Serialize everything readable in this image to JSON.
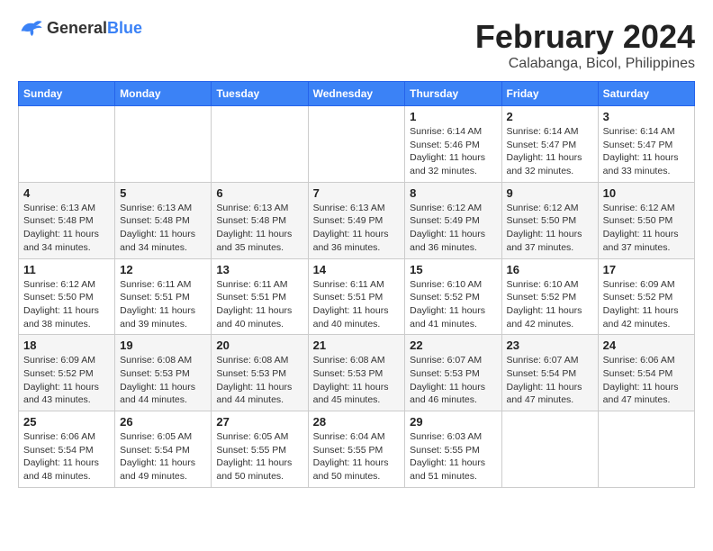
{
  "header": {
    "logo_general": "General",
    "logo_blue": "Blue",
    "month_title": "February 2024",
    "subtitle": "Calabanga, Bicol, Philippines"
  },
  "days_of_week": [
    "Sunday",
    "Monday",
    "Tuesday",
    "Wednesday",
    "Thursday",
    "Friday",
    "Saturday"
  ],
  "weeks": [
    [
      {
        "day": "",
        "info": ""
      },
      {
        "day": "",
        "info": ""
      },
      {
        "day": "",
        "info": ""
      },
      {
        "day": "",
        "info": ""
      },
      {
        "day": "1",
        "info": "Sunrise: 6:14 AM\nSunset: 5:46 PM\nDaylight: 11 hours and 32 minutes."
      },
      {
        "day": "2",
        "info": "Sunrise: 6:14 AM\nSunset: 5:47 PM\nDaylight: 11 hours and 32 minutes."
      },
      {
        "day": "3",
        "info": "Sunrise: 6:14 AM\nSunset: 5:47 PM\nDaylight: 11 hours and 33 minutes."
      }
    ],
    [
      {
        "day": "4",
        "info": "Sunrise: 6:13 AM\nSunset: 5:48 PM\nDaylight: 11 hours and 34 minutes."
      },
      {
        "day": "5",
        "info": "Sunrise: 6:13 AM\nSunset: 5:48 PM\nDaylight: 11 hours and 34 minutes."
      },
      {
        "day": "6",
        "info": "Sunrise: 6:13 AM\nSunset: 5:48 PM\nDaylight: 11 hours and 35 minutes."
      },
      {
        "day": "7",
        "info": "Sunrise: 6:13 AM\nSunset: 5:49 PM\nDaylight: 11 hours and 36 minutes."
      },
      {
        "day": "8",
        "info": "Sunrise: 6:12 AM\nSunset: 5:49 PM\nDaylight: 11 hours and 36 minutes."
      },
      {
        "day": "9",
        "info": "Sunrise: 6:12 AM\nSunset: 5:50 PM\nDaylight: 11 hours and 37 minutes."
      },
      {
        "day": "10",
        "info": "Sunrise: 6:12 AM\nSunset: 5:50 PM\nDaylight: 11 hours and 37 minutes."
      }
    ],
    [
      {
        "day": "11",
        "info": "Sunrise: 6:12 AM\nSunset: 5:50 PM\nDaylight: 11 hours and 38 minutes."
      },
      {
        "day": "12",
        "info": "Sunrise: 6:11 AM\nSunset: 5:51 PM\nDaylight: 11 hours and 39 minutes."
      },
      {
        "day": "13",
        "info": "Sunrise: 6:11 AM\nSunset: 5:51 PM\nDaylight: 11 hours and 40 minutes."
      },
      {
        "day": "14",
        "info": "Sunrise: 6:11 AM\nSunset: 5:51 PM\nDaylight: 11 hours and 40 minutes."
      },
      {
        "day": "15",
        "info": "Sunrise: 6:10 AM\nSunset: 5:52 PM\nDaylight: 11 hours and 41 minutes."
      },
      {
        "day": "16",
        "info": "Sunrise: 6:10 AM\nSunset: 5:52 PM\nDaylight: 11 hours and 42 minutes."
      },
      {
        "day": "17",
        "info": "Sunrise: 6:09 AM\nSunset: 5:52 PM\nDaylight: 11 hours and 42 minutes."
      }
    ],
    [
      {
        "day": "18",
        "info": "Sunrise: 6:09 AM\nSunset: 5:52 PM\nDaylight: 11 hours and 43 minutes."
      },
      {
        "day": "19",
        "info": "Sunrise: 6:08 AM\nSunset: 5:53 PM\nDaylight: 11 hours and 44 minutes."
      },
      {
        "day": "20",
        "info": "Sunrise: 6:08 AM\nSunset: 5:53 PM\nDaylight: 11 hours and 44 minutes."
      },
      {
        "day": "21",
        "info": "Sunrise: 6:08 AM\nSunset: 5:53 PM\nDaylight: 11 hours and 45 minutes."
      },
      {
        "day": "22",
        "info": "Sunrise: 6:07 AM\nSunset: 5:53 PM\nDaylight: 11 hours and 46 minutes."
      },
      {
        "day": "23",
        "info": "Sunrise: 6:07 AM\nSunset: 5:54 PM\nDaylight: 11 hours and 47 minutes."
      },
      {
        "day": "24",
        "info": "Sunrise: 6:06 AM\nSunset: 5:54 PM\nDaylight: 11 hours and 47 minutes."
      }
    ],
    [
      {
        "day": "25",
        "info": "Sunrise: 6:06 AM\nSunset: 5:54 PM\nDaylight: 11 hours and 48 minutes."
      },
      {
        "day": "26",
        "info": "Sunrise: 6:05 AM\nSunset: 5:54 PM\nDaylight: 11 hours and 49 minutes."
      },
      {
        "day": "27",
        "info": "Sunrise: 6:05 AM\nSunset: 5:55 PM\nDaylight: 11 hours and 50 minutes."
      },
      {
        "day": "28",
        "info": "Sunrise: 6:04 AM\nSunset: 5:55 PM\nDaylight: 11 hours and 50 minutes."
      },
      {
        "day": "29",
        "info": "Sunrise: 6:03 AM\nSunset: 5:55 PM\nDaylight: 11 hours and 51 minutes."
      },
      {
        "day": "",
        "info": ""
      },
      {
        "day": "",
        "info": ""
      }
    ]
  ]
}
